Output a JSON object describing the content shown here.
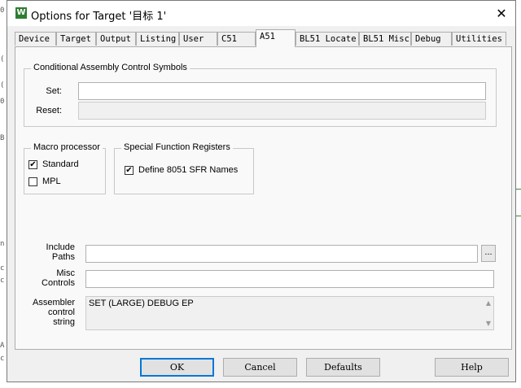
{
  "window": {
    "title": "Options for Target '目标 1'",
    "icon_glyph": "W",
    "close_glyph": "✕"
  },
  "tabs": [
    {
      "label": "Device"
    },
    {
      "label": "Target"
    },
    {
      "label": "Output"
    },
    {
      "label": "Listing"
    },
    {
      "label": "User"
    },
    {
      "label": "C51"
    },
    {
      "label": "A51",
      "active": true
    },
    {
      "label": "BL51 Locate"
    },
    {
      "label": "BL51 Misc"
    },
    {
      "label": "Debug"
    },
    {
      "label": "Utilities"
    }
  ],
  "conditional": {
    "legend": "Conditional Assembly Control Symbols",
    "set_label": "Set:",
    "set_value": "",
    "reset_label": "Reset:",
    "reset_value": ""
  },
  "macro": {
    "legend": "Macro processor",
    "standard_label": "Standard",
    "standard_checked": "✔",
    "mpl_label": "MPL"
  },
  "sfr": {
    "legend": "Special Function Registers",
    "define_label": "Define 8051 SFR Names",
    "define_checked": "✔"
  },
  "paths": {
    "include_label_1": "Include",
    "include_label_2": "Paths",
    "include_value": "",
    "browse_label": "...",
    "misc_label_1": "Misc",
    "misc_label_2": "Controls",
    "misc_value": "",
    "asm_label_1": "Assembler",
    "asm_label_2": "control",
    "asm_label_3": "string",
    "asm_value": "SET (LARGE) DEBUG EP",
    "scroll_up": "▲",
    "scroll_down": "▼"
  },
  "buttons": {
    "ok": "OK",
    "cancel": "Cancel",
    "defaults": "Defaults",
    "help": "Help"
  },
  "background_fragments": [
    "0",
    "(",
    "(",
    "0",
    "B",
    "n",
    "c",
    "c",
    "A",
    "c"
  ]
}
